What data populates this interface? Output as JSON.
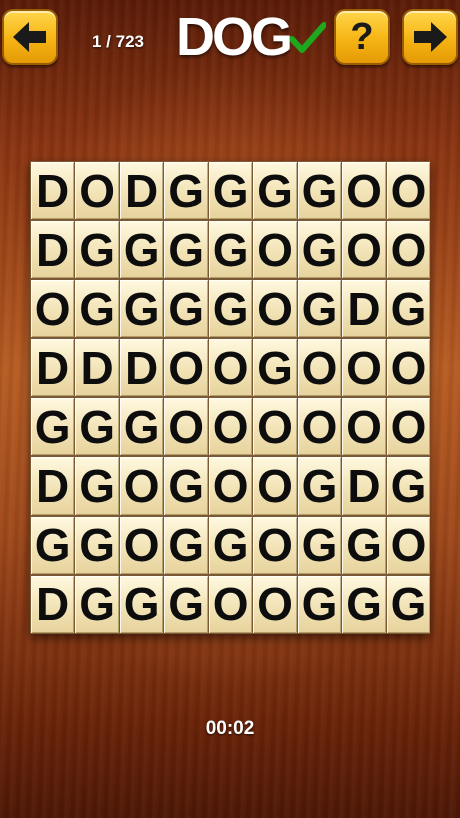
{
  "header": {
    "level_counter": "1 / 723",
    "target_word": "DOG",
    "icons": {
      "back": "arrow-left-icon",
      "help": "question-mark-icon",
      "next": "arrow-right-icon",
      "solved": "checkmark-icon"
    },
    "help_label": "?"
  },
  "colors": {
    "button_face": "#f6b414",
    "check_green": "#1ea81e",
    "tile_face": "#f2e3b6",
    "letter": "#0d0d0d"
  },
  "grid": {
    "rows": 8,
    "cols": 9,
    "cells": [
      [
        "D",
        "O",
        "D",
        "G",
        "G",
        "G",
        "G",
        "O",
        "O"
      ],
      [
        "D",
        "G",
        "G",
        "G",
        "G",
        "O",
        "G",
        "O",
        "O"
      ],
      [
        "O",
        "G",
        "G",
        "G",
        "G",
        "O",
        "G",
        "D",
        "G"
      ],
      [
        "D",
        "D",
        "D",
        "O",
        "O",
        "G",
        "O",
        "O",
        "O"
      ],
      [
        "G",
        "G",
        "G",
        "O",
        "O",
        "O",
        "O",
        "O",
        "O"
      ],
      [
        "D",
        "G",
        "O",
        "G",
        "O",
        "O",
        "G",
        "D",
        "G"
      ],
      [
        "G",
        "G",
        "O",
        "G",
        "G",
        "O",
        "G",
        "G",
        "O"
      ],
      [
        "D",
        "G",
        "G",
        "G",
        "O",
        "O",
        "G",
        "G",
        "G"
      ]
    ]
  },
  "footer": {
    "timer": "00:02"
  }
}
